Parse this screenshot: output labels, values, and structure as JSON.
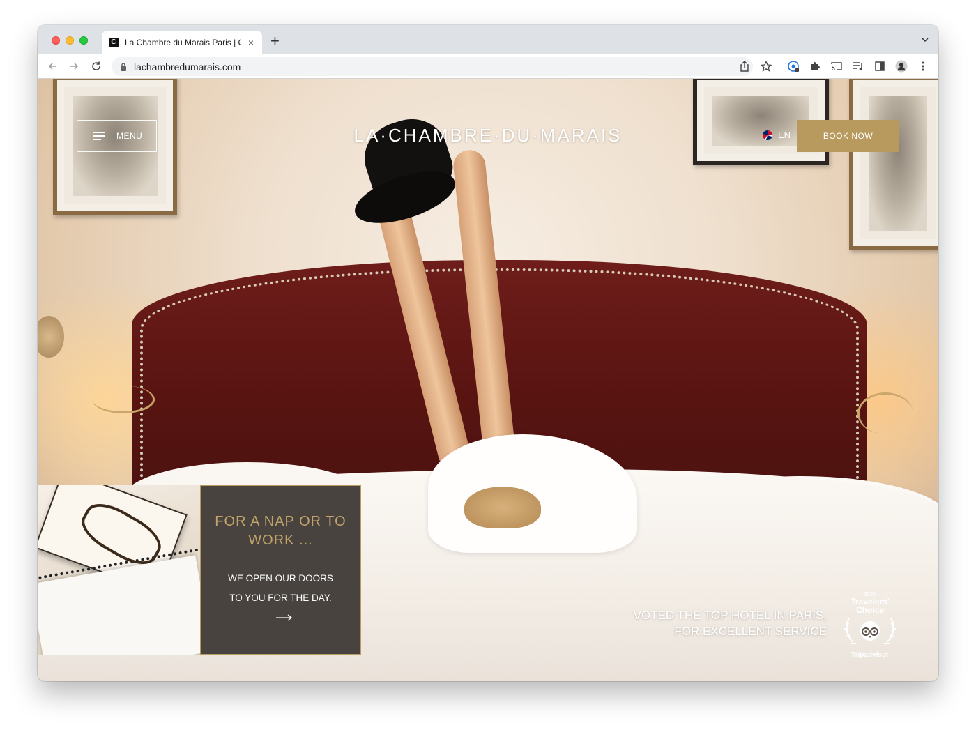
{
  "browser": {
    "tab_favicon": "C",
    "tab_title": "La Chambre du Marais Paris | C",
    "tab_close": "×",
    "new_tab": "+",
    "url": "lachambredumarais.com"
  },
  "site": {
    "menu_label": "MENU",
    "logo": "LA·CHAMBRE·DU·MARAIS",
    "language": "EN",
    "book_label": "BOOK NOW",
    "accent_color": "#b89a5e"
  },
  "promo": {
    "heading": "FOR A NAP OR TO WORK ...",
    "body": "WE OPEN OUR DOORS TO YOU FOR THE DAY."
  },
  "award": {
    "text": "VOTED THE TOP HOTEL IN PARIS, FOR EXCELLENT SERVICE",
    "badge_year": "2021",
    "badge_line1": "Travelers'",
    "badge_line2": "Choice",
    "badge_brand": "Tripadvisor"
  }
}
